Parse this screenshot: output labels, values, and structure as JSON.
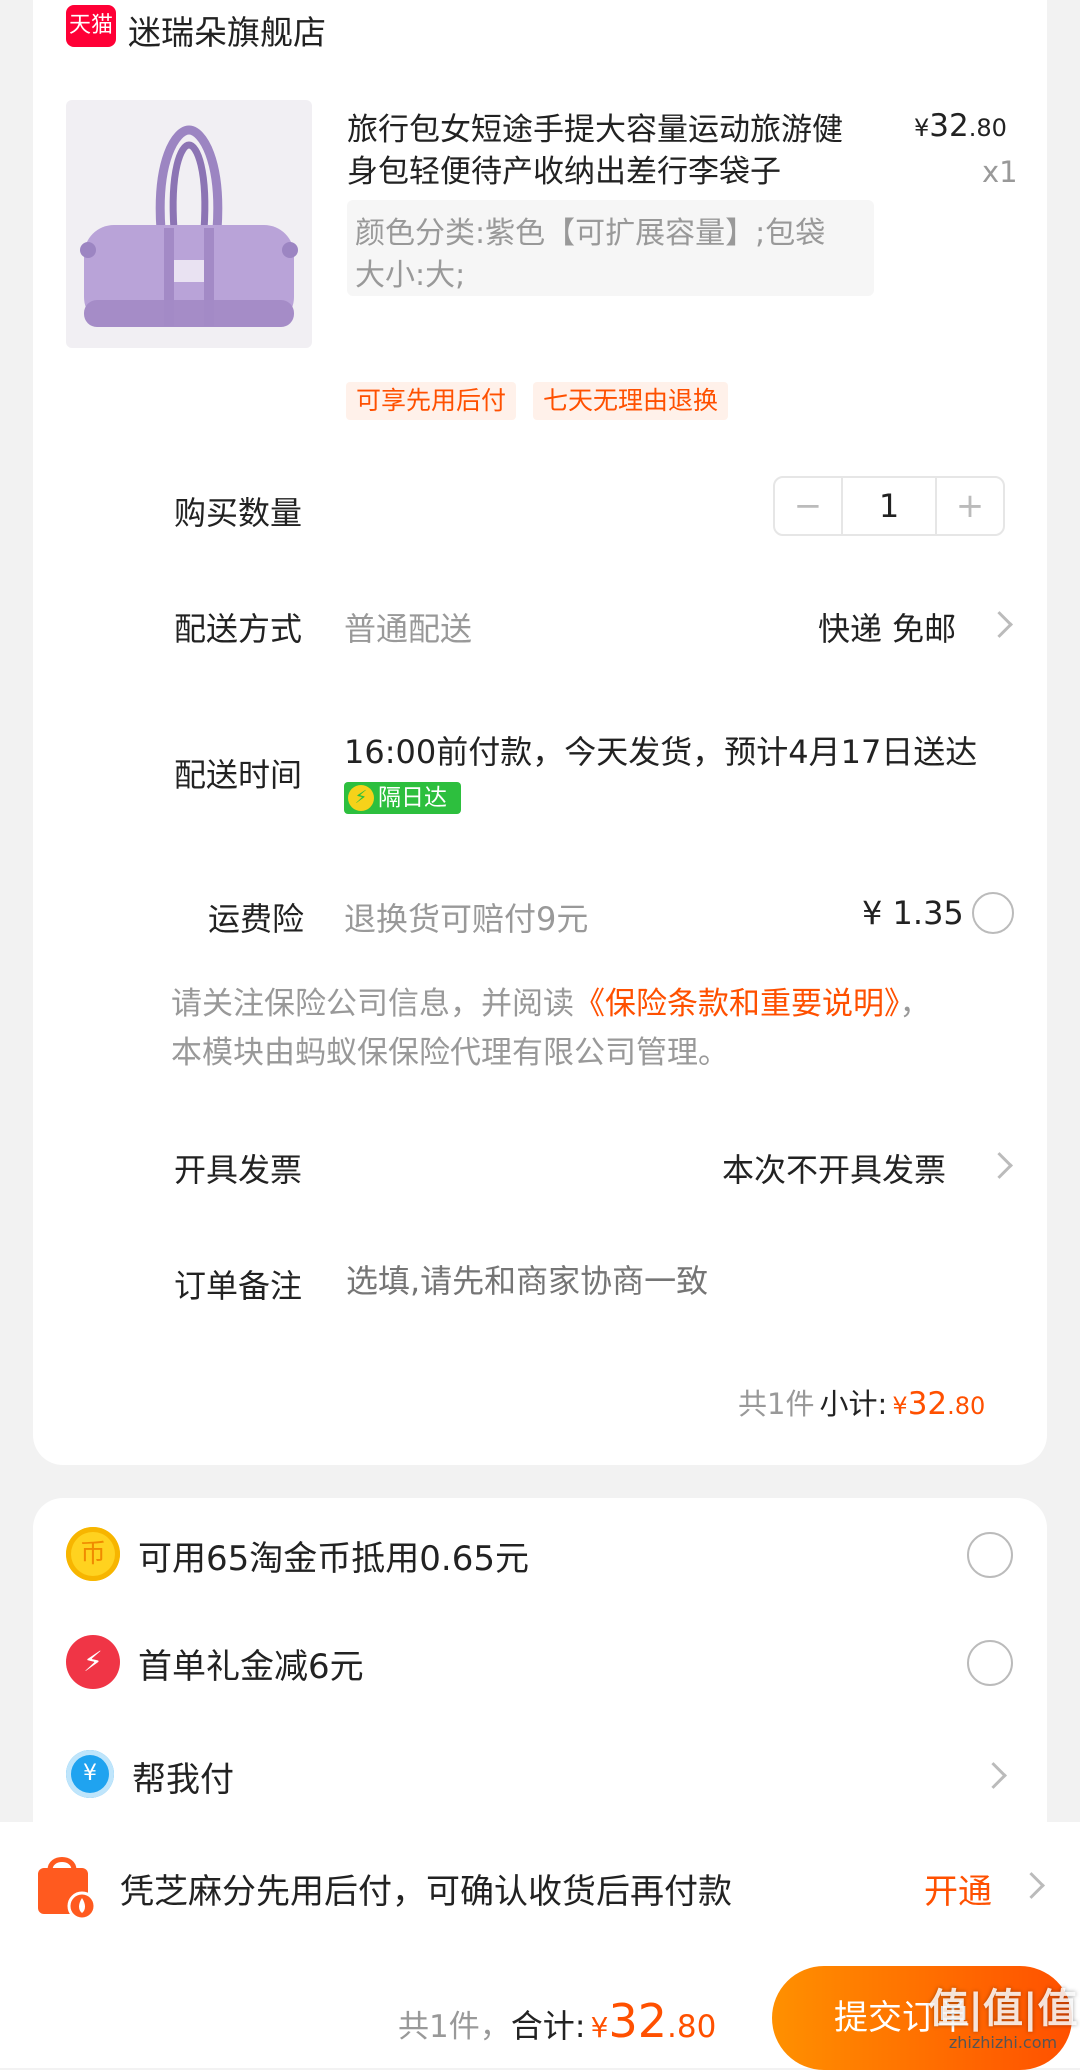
{
  "shop": {
    "badge": "天猫",
    "name": "迷瑞朵旗舰店"
  },
  "product": {
    "title_line1": "旅行包女短途手提大容量运动旅游健",
    "title_line2": "身包轻便待产收纳出差行李袋子",
    "price_symbol": "¥",
    "price_int": "32",
    "price_dec": ".80",
    "qty": "x1",
    "sku_line1": "颜色分类:紫色【可扩展容量】;包袋",
    "sku_line2": "大小:大;",
    "tags": [
      "可享先用后付",
      "七天无理由退换"
    ],
    "image_icon": "purple-travel-bag"
  },
  "quantity": {
    "label": "购买数量",
    "minus": "−",
    "value": "1",
    "plus": "+"
  },
  "delivery": {
    "label": "配送方式",
    "method": "普通配送",
    "value": "快递 免邮"
  },
  "delivery_time": {
    "label": "配送时间",
    "text": "16:00前付款，今天发货，预计4月17日送达",
    "badge": "隔日达"
  },
  "insurance": {
    "label": "运费险",
    "desc": "退换货可赔付9元",
    "price": "¥ 1.35",
    "notice_prefix": "请关注保险公司信息，并阅读",
    "notice_link": "《保险条款和重要说明》",
    "notice_suffix": "，",
    "notice_line2": "本模块由蚂蚁保保险代理有限公司管理。"
  },
  "invoice": {
    "label": "开具发票",
    "value": "本次不开具发票"
  },
  "remark": {
    "label": "订单备注",
    "placeholder": "选填,请先和商家协商一致"
  },
  "subtotal": {
    "count": "共1件",
    "label": "小计:",
    "symbol": "¥",
    "int": "32",
    "dec": ".80"
  },
  "benefits": [
    {
      "icon": "gold-coin-icon",
      "text": "可用65淘金币抵用0.65元"
    },
    {
      "icon": "red-gift-icon",
      "text": "首单礼金减6元"
    },
    {
      "icon": "blue-yen-icon",
      "text": "帮我付"
    }
  ],
  "paylater": {
    "text": "凭芝麻分先用后付，可确认收货后再付款",
    "action": "开通"
  },
  "footer": {
    "count": "共1件，",
    "label": "合计:",
    "symbol": "¥",
    "int": "32",
    "dec": ".80",
    "submit": "提交订单"
  },
  "watermark": {
    "main": "值|值|值",
    "sub": "zhizhizhi.com"
  },
  "colors": {
    "accent": "#ff5000",
    "tmall": "#ff0036",
    "green": "#2dbf3e"
  }
}
